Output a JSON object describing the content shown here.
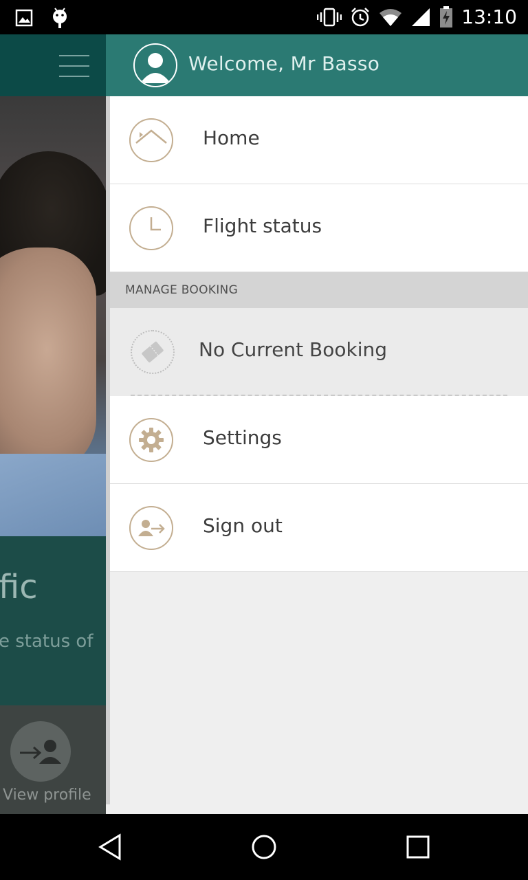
{
  "status_bar": {
    "time": "13:10",
    "icons": [
      "image-notification-icon",
      "android-notification-icon",
      "vibrate-icon",
      "alarm-icon",
      "wifi-icon",
      "signal-icon",
      "battery-charging-icon"
    ]
  },
  "background": {
    "card_title": "fic",
    "card_subtitle": "e status of",
    "view_profile_label": "View profile"
  },
  "drawer": {
    "welcome": "Welcome, Mr Basso",
    "items": [
      {
        "label": "Home",
        "icon": "home-icon"
      },
      {
        "label": "Flight status",
        "icon": "clock-icon"
      }
    ],
    "section_header": "MANAGE BOOKING",
    "booking": {
      "label": "No Current Booking",
      "icon": "ticket-icon"
    },
    "footer_items": [
      {
        "label": "Settings",
        "icon": "gear-icon"
      },
      {
        "label": "Sign out",
        "icon": "sign-out-icon"
      }
    ]
  },
  "colors": {
    "header_teal": "#2b7a73",
    "icon_gold": "#c3ae91"
  }
}
